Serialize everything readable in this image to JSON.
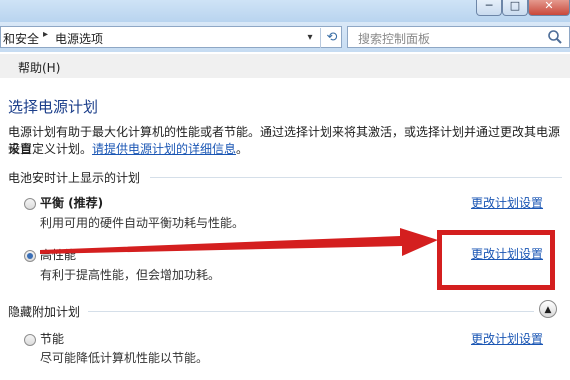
{
  "window": {
    "minimize": "─",
    "maximize": "□",
    "close": "✕"
  },
  "address": {
    "crumb1": "和安全",
    "separator": "▸",
    "crumb2": "电源选项",
    "dropdown": "▾",
    "refresh_icon": "refresh-icon"
  },
  "search": {
    "placeholder": "搜索控制面板",
    "icon": "search-icon"
  },
  "menu": {
    "help": "帮助(H)"
  },
  "page": {
    "heading": "选择电源计划",
    "desc_line1": "电源计划有助于最大化计算机的性能或者节能。通过选择计划来将其激活，或选择计划并通过更改其电源设置",
    "desc_line2_prefix": "来自定义计划。",
    "desc_link": "请提供电源计划的详细信息",
    "desc_line2_suffix": "。"
  },
  "sections": {
    "battery_plans": "电池安时计上显示的计划",
    "hidden_plans": "隐藏附加计划"
  },
  "plans": [
    {
      "name": "平衡 (推荐)",
      "description": "利用可用的硬件自动平衡功耗与性能。",
      "change_label": "更改计划设置",
      "selected": false
    },
    {
      "name": "高性能",
      "description": "有利于提高性能，但会增加功耗。",
      "change_label": "更改计划设置",
      "selected": true
    },
    {
      "name": "节能",
      "description": "尽可能降低计算机性能以节能。",
      "change_label": "更改计划设置",
      "selected": false
    }
  ],
  "collapse_icon": "chevron-up-icon",
  "annotation_color": "#d41f1f",
  "accent_link_color": "#1a56b4"
}
